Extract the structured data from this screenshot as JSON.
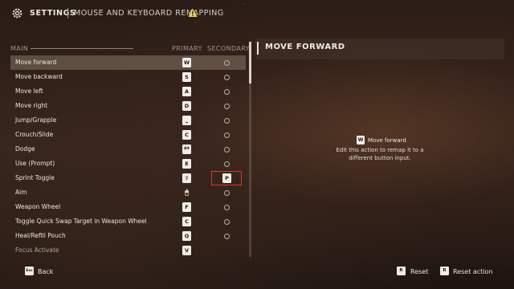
{
  "header": {
    "title": "SETTINGS",
    "subtitle": "MOUSE AND KEYBOARD REMAPPING",
    "debug_overlay": "..."
  },
  "columns": {
    "main": "MAIN",
    "primary": "PRIMARY",
    "secondary": "SECONDARY"
  },
  "actions": [
    {
      "label": "Move forward",
      "primary": "W"
    },
    {
      "label": "Move backward",
      "primary": "S"
    },
    {
      "label": "Move left",
      "primary": "A"
    },
    {
      "label": "Move right",
      "primary": "D"
    },
    {
      "label": "Jump/Grapple",
      "primary": "⎵"
    },
    {
      "label": "Crouch/Slide",
      "primary": "C"
    },
    {
      "label": "Dodge",
      "primary": "Alt"
    },
    {
      "label": "Use (Prompt)",
      "primary": "E"
    },
    {
      "label": "Sprint Toggle",
      "primary": "⇧",
      "secondary": "P"
    },
    {
      "label": "Aim",
      "primary": "🖱"
    },
    {
      "label": "Weapon Wheel",
      "primary": "F"
    },
    {
      "label": "Toggle Quick Swap Target in Weapon Wheel",
      "primary": "C"
    },
    {
      "label": "Heal/Refill Pouch",
      "primary": "Q"
    },
    {
      "label": "Focus Activate",
      "primary": "V"
    }
  ],
  "detail": {
    "title": "MOVE FORWARD",
    "key": "W",
    "name": "Move forward",
    "description": "Edit this action to remap it to a different button input."
  },
  "footer": {
    "back_key": "Esc",
    "back_label": "Back",
    "reset_key": "R",
    "reset_label": "Reset",
    "reset_action_key": "R",
    "reset_action_label": "Reset action"
  },
  "colors": {
    "accent": "#e03030",
    "selected_row": "#a08e7d",
    "background": "#2a1c16"
  }
}
